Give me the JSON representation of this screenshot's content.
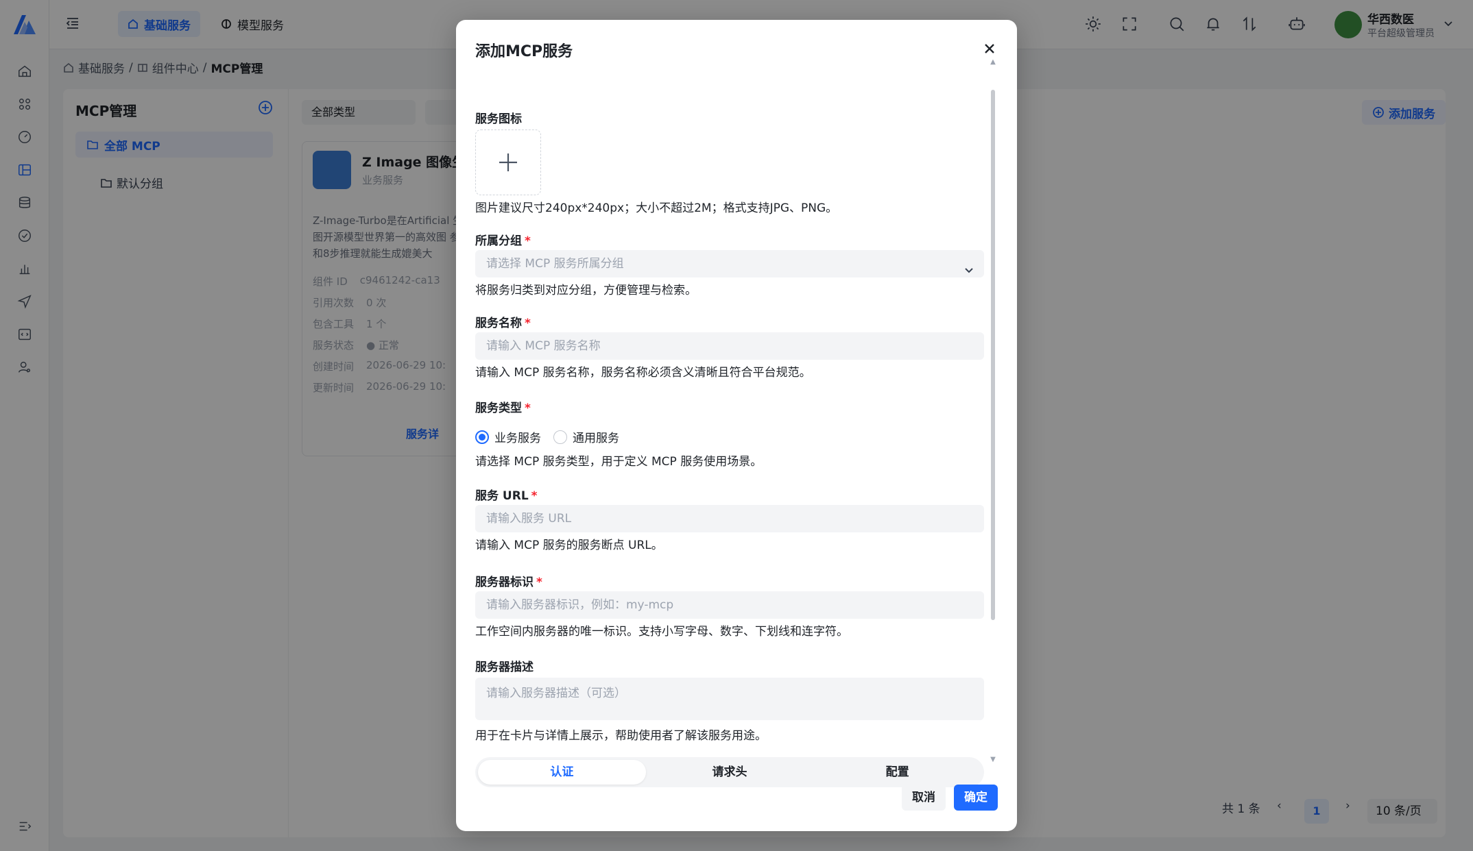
{
  "app": {
    "top_tabs": [
      {
        "label": "基础服务",
        "active": true
      },
      {
        "label": "模型服务",
        "active": false
      }
    ],
    "user": {
      "name": "华西数医",
      "role": "平台超级管理员"
    },
    "breadcrumb": [
      "基础服务",
      "组件中心",
      "MCP管理"
    ],
    "breadcrumb_sep": "/"
  },
  "tree": {
    "title": "MCP管理",
    "items": [
      {
        "label": "全部 MCP",
        "active": true
      },
      {
        "label": "默认分组",
        "active": false
      }
    ]
  },
  "toolbar": {
    "type_filter": "全部类型",
    "add_service_label": "添加服务"
  },
  "card": {
    "title": "Z Image 图像生",
    "subtitle": "业务服务",
    "description": "Z-Image-Turbo是在Artificial 生图开源模型世界第一的高效图 参数和8步推理就能生成媲美大",
    "rows": [
      {
        "k": "组件 ID",
        "v": "c9461242-ca13"
      },
      {
        "k": "引用次数",
        "v": "0 次"
      },
      {
        "k": "包含工具",
        "v": "1 个"
      },
      {
        "k": "服务状态",
        "v": "● 正常"
      },
      {
        "k": "创建时间",
        "v": "2026-06-29 10:"
      },
      {
        "k": "更新时间",
        "v": "2026-06-29 10:"
      }
    ],
    "link_label": "服务详"
  },
  "pagination": {
    "total": "共 1 条",
    "current": "1",
    "page_size": "10 条/页"
  },
  "modal": {
    "title": "添加MCP服务",
    "icon_field": {
      "label": "服务图标",
      "help": "图片建议尺寸240px*240px；大小不超过2M；格式支持JPG、PNG。"
    },
    "group_field": {
      "label": "所属分组",
      "placeholder": "请选择 MCP 服务所属分组",
      "help": "将服务归类到对应分组，方便管理与检索。"
    },
    "name_field": {
      "label": "服务名称",
      "placeholder": "请输入 MCP 服务名称",
      "help": "请输入 MCP 服务名称，服务名称必须含义清晰且符合平台规范。"
    },
    "type_field": {
      "label": "服务类型",
      "options": [
        "业务服务",
        "通用服务"
      ],
      "selected": "业务服务",
      "help": "请选择 MCP 服务类型，用于定义 MCP 服务使用场景。"
    },
    "url_field": {
      "label": "服务 URL",
      "placeholder": "请输入服务 URL",
      "help": "请输入 MCP 服务的服务断点 URL。"
    },
    "id_field": {
      "label": "服务器标识",
      "placeholder": "请输入服务器标识，例如：my-mcp",
      "help": "工作空间内服务器的唯一标识。支持小写字母、数字、下划线和连字符。"
    },
    "desc_field": {
      "label": "服务器描述",
      "placeholder": "请输入服务器描述（可选）",
      "help": "用于在卡片与详情上展示，帮助使用者了解该服务用途。"
    },
    "segments": [
      {
        "label": "认证",
        "active": true
      },
      {
        "label": "请求头",
        "active": false
      },
      {
        "label": "配置",
        "active": false
      }
    ],
    "cancel_label": "取消",
    "ok_label": "确定"
  },
  "colors": {
    "primary": "#1f6bff",
    "required": "#f5222d",
    "overlay": "rgba(0,0,0,0.45)"
  }
}
